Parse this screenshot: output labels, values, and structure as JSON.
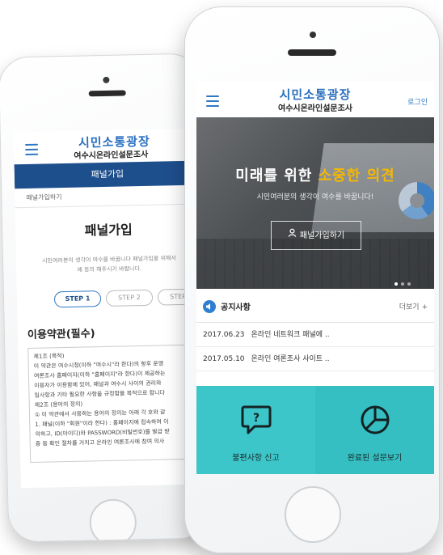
{
  "back_phone": {
    "logo_main": "시민소통광장",
    "logo_sub": "여수시온라인설문조사",
    "band": "패널가입",
    "breadcrumb": "패널가입하기",
    "title": "패널가입",
    "desc_line1": "시민여러분의 생각이 여수를 바꿉니다 패널가입을 위해서",
    "desc_line2": "에 동의 해주시기 바랍니다.",
    "steps": [
      "STEP 1",
      "STEP 2",
      "STEP 3"
    ],
    "terms_title": "이용약관(필수)",
    "terms_lines": [
      "제1조 (목적)",
      "이 약관은 여수시청(이하 \"여수시\"라 한다)의 항후 운영",
      "여론조사 홈페이지(이하 \"홈페이지\"라 한다)이 제공하는",
      "이용자가 이용함에 있어, 패널과 여수시 사이의 권리와",
      "임사항과 기타 필요한 사항을 규정함을 목적으로 합니다",
      "제2조 (용어의 정의)",
      "① 이 약관에서 사용하는 용어의 정의는 아래 각 호와 같",
      "1. 패널(이하 \"회원\"이라 한다) : 홈페이지에 접속하여 이",
      "의하고, ID(아이디)와 PASSWORD(비밀번호)를 발급 받",
      "증 등 확인 절차를 거치고 온라인 여론조사에 참여 의사"
    ]
  },
  "front_phone": {
    "logo_main": "시민소통광장",
    "logo_sub": "여수시온라인설문조사",
    "login": "로그인",
    "hero": {
      "title_a": "미래를 위한 ",
      "title_b": "소중한 의견",
      "subtitle": "시민여러분의 생각이 여수를 바꿉니다!",
      "button": "패널가입하기"
    },
    "notice": {
      "title": "공지사항",
      "more": "더보기 +",
      "items": [
        {
          "date": "2017.06.23",
          "text": "온라인 네트워크 패널에 .."
        },
        {
          "date": "2017.05.10",
          "text": "온라인 여론조사 사이트 .."
        }
      ]
    },
    "tiles": [
      {
        "label": "불편사항 신고"
      },
      {
        "label": "완료된 설문보기"
      }
    ]
  },
  "colors": {
    "brand_blue": "#2a6fbf",
    "band_navy": "#1e4f8d",
    "accent_yellow": "#f5b800",
    "tile_teal": "#3cc6c9"
  }
}
